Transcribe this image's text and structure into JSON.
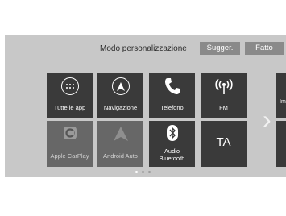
{
  "header": {
    "title": "Modo personalizzazione",
    "sugger_label": "Sugger.",
    "fatto_label": "Fatto"
  },
  "tiles": {
    "tutte": "Tutte le app",
    "navigazione": "Navigazione",
    "telefono": "Telefono",
    "fm": "FM",
    "carplay": "Apple CarPlay",
    "android": "Android Auto",
    "audio_bt": "Audio\nBluetooth",
    "ta": "TA",
    "next_partial": "Im"
  },
  "icons": {
    "tutte": "apps-grid-icon",
    "navigazione": "navigation-arrow-icon",
    "telefono": "phone-icon",
    "fm": "radio-antenna-icon",
    "carplay": "carplay-icon",
    "android": "android-auto-icon",
    "audio_bt": "bluetooth-icon",
    "next_page": "chevron-right-icon"
  },
  "pagination": {
    "pages": 3,
    "current": 1
  }
}
